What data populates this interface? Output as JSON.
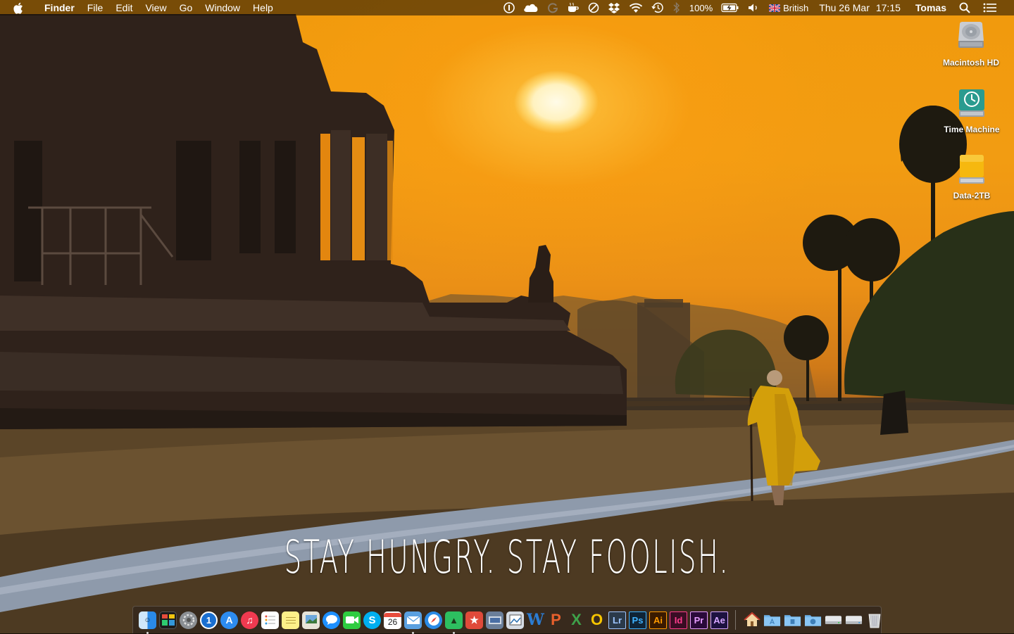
{
  "menubar": {
    "app_name": "Finder",
    "menus": [
      "File",
      "Edit",
      "View",
      "Go",
      "Window",
      "Help"
    ],
    "battery_percent": "100%",
    "input_source": "British",
    "date": "Thu 26 Mar",
    "time": "17:15",
    "user": "Tomas"
  },
  "desktop": {
    "icons": [
      {
        "label": "Macintosh HD",
        "icon": "internal-drive-icon"
      },
      {
        "label": "Time Machine",
        "icon": "time-machine-drive-icon"
      },
      {
        "label": "Data-2TB",
        "icon": "external-drive-icon"
      }
    ],
    "wallpaper_quote": "STAY HUNGRY. STAY FOOLISH."
  },
  "dock": {
    "apps": [
      {
        "name": "Finder",
        "icon": "finder-icon",
        "running": true
      },
      {
        "name": "Mission Control",
        "icon": "mission-control-icon",
        "running": false
      },
      {
        "name": "System Preferences",
        "icon": "system-preferences-icon",
        "running": false
      },
      {
        "name": "1Password",
        "icon": "1password-icon",
        "running": false
      },
      {
        "name": "App Store",
        "icon": "app-store-icon",
        "running": false
      },
      {
        "name": "iTunes",
        "icon": "itunes-icon",
        "running": false
      },
      {
        "name": "Reminders",
        "icon": "reminders-icon",
        "running": false
      },
      {
        "name": "Notes",
        "icon": "notes-icon",
        "running": false
      },
      {
        "name": "Preview",
        "icon": "preview-icon",
        "running": false
      },
      {
        "name": "Messages",
        "icon": "messages-icon",
        "running": false
      },
      {
        "name": "FaceTime",
        "icon": "facetime-icon",
        "running": false
      },
      {
        "name": "Skype",
        "icon": "skype-icon",
        "running": false
      },
      {
        "name": "Calendar",
        "icon": "calendar-icon",
        "running": false,
        "badge_text": "26"
      },
      {
        "name": "Mail",
        "icon": "mail-icon",
        "running": true
      },
      {
        "name": "Safari",
        "icon": "safari-icon",
        "running": false
      },
      {
        "name": "Evernote",
        "icon": "evernote-icon",
        "running": true
      },
      {
        "name": "Wunderlist",
        "icon": "wunderlist-icon",
        "running": false
      },
      {
        "name": "Image Capture",
        "icon": "image-capture-icon",
        "running": false
      },
      {
        "name": "Photo Viewer",
        "icon": "photo-viewer-icon",
        "running": false
      },
      {
        "name": "Word",
        "icon": "word-icon",
        "running": false,
        "glyph": "W"
      },
      {
        "name": "PowerPoint",
        "icon": "powerpoint-icon",
        "running": false,
        "glyph": "P"
      },
      {
        "name": "Excel",
        "icon": "excel-icon",
        "running": false,
        "glyph": "X"
      },
      {
        "name": "Outlook",
        "icon": "outlook-icon",
        "running": false,
        "glyph": "O"
      },
      {
        "name": "Lightroom",
        "icon": "lightroom-icon",
        "running": false,
        "glyph": "Lr"
      },
      {
        "name": "Photoshop",
        "icon": "photoshop-icon",
        "running": false,
        "glyph": "Ps"
      },
      {
        "name": "Illustrator",
        "icon": "illustrator-icon",
        "running": false,
        "glyph": "Ai"
      },
      {
        "name": "InDesign",
        "icon": "indesign-icon",
        "running": false,
        "glyph": "Id"
      },
      {
        "name": "Premiere Pro",
        "icon": "premiere-icon",
        "running": false,
        "glyph": "Pr"
      },
      {
        "name": "After Effects",
        "icon": "after-effects-icon",
        "running": false,
        "glyph": "Ae"
      }
    ],
    "stacks": [
      {
        "name": "Home",
        "icon": "home-folder-icon"
      },
      {
        "name": "Applications",
        "icon": "applications-folder-icon"
      },
      {
        "name": "Documents",
        "icon": "documents-folder-icon"
      },
      {
        "name": "Downloads",
        "icon": "downloads-folder-icon"
      },
      {
        "name": "Drive",
        "icon": "drive-icon"
      },
      {
        "name": "Drive 2",
        "icon": "drive-icon"
      },
      {
        "name": "Trash",
        "icon": "trash-icon"
      }
    ]
  },
  "colors": {
    "sky": "#f19a0c",
    "robe": "#d8a40a",
    "adobe_lr": "#2b3a4a",
    "adobe_ps": "#0f2436",
    "adobe_ai": "#3a1a00",
    "adobe_id": "#3a0d24",
    "adobe_pr": "#2a0a3a",
    "adobe_ae": "#1d1240"
  }
}
